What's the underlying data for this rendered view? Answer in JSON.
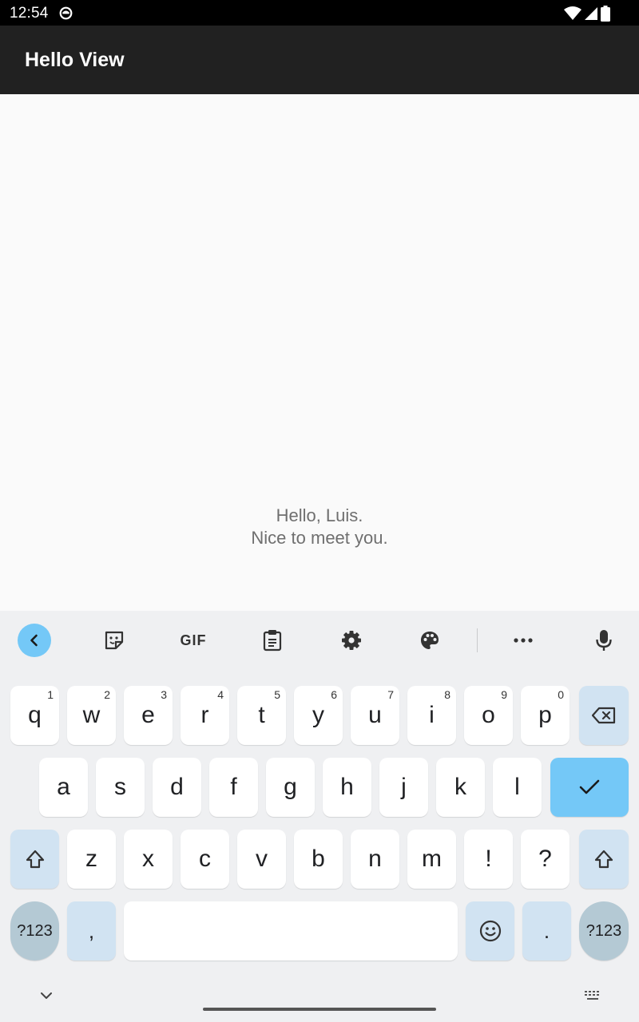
{
  "status_bar": {
    "time": "12:54"
  },
  "app_bar": {
    "title": "Hello View"
  },
  "content": {
    "greeting_line1": "Hello, Luis.",
    "greeting_line2": "Nice to meet you."
  },
  "keyboard": {
    "toolbar": {
      "gif_label": "GIF"
    },
    "row1": [
      {
        "label": "q",
        "hint": "1"
      },
      {
        "label": "w",
        "hint": "2"
      },
      {
        "label": "e",
        "hint": "3"
      },
      {
        "label": "r",
        "hint": "4"
      },
      {
        "label": "t",
        "hint": "5"
      },
      {
        "label": "y",
        "hint": "6"
      },
      {
        "label": "u",
        "hint": "7"
      },
      {
        "label": "i",
        "hint": "8"
      },
      {
        "label": "o",
        "hint": "9"
      },
      {
        "label": "p",
        "hint": "0"
      }
    ],
    "row2": [
      "a",
      "s",
      "d",
      "f",
      "g",
      "h",
      "j",
      "k",
      "l"
    ],
    "row3": [
      "z",
      "x",
      "c",
      "v",
      "b",
      "n",
      "m",
      "!",
      "?"
    ],
    "symbols_label": "?123",
    "comma_label": ",",
    "period_label": "."
  },
  "colors": {
    "accent": "#74c8f7",
    "function_key": "#d1e3f2",
    "app_bar": "#212121"
  }
}
